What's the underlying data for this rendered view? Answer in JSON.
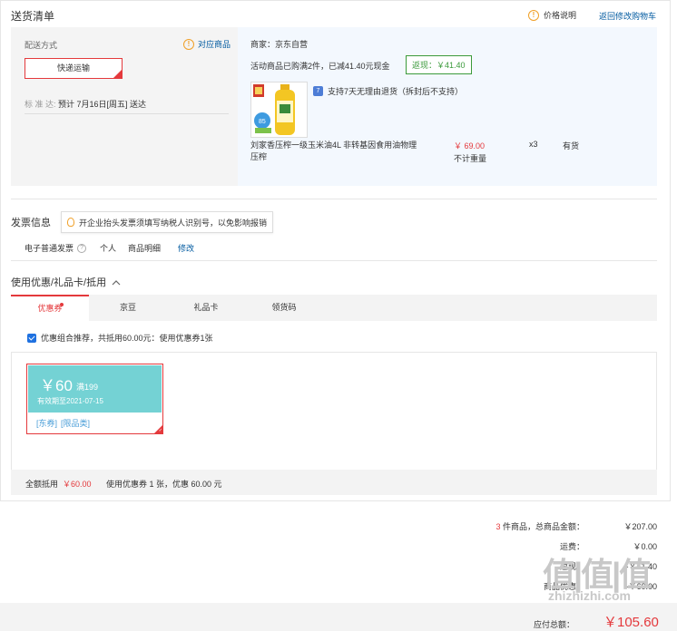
{
  "header": {
    "title": "送货清单",
    "price_explain": "价格说明",
    "back_cart": "返回修改购物车"
  },
  "shipping": {
    "label": "配送方式",
    "match_goods": "对应商品",
    "method": "快递运输",
    "std_label": "标 准 达:",
    "std_time": "预计 7月16日[周五] 送达"
  },
  "goods": {
    "merchant": "商家：京东自营",
    "promo": "活动商品已购满2件，已减41.40元现金",
    "cashback": "返现：￥41.40",
    "return_policy": "支持7天无理由退货（拆封后不支持）",
    "return_badge": "7",
    "name": "刘家香压榨一级玉米油4L 非转基因食用油物理压榨",
    "price": "￥ 69.00",
    "no_weight": "不计重量",
    "qty": "x3",
    "stock": "有货",
    "img_badge": "85"
  },
  "invoice": {
    "title": "发票信息",
    "tip": "开企业抬头发票须填写纳税人识别号，以免影响报销",
    "type": "电子普通发票",
    "person": "个人",
    "detail": "商品明细",
    "edit": "修改"
  },
  "coupon": {
    "title": "使用优惠/礼品卡/抵用",
    "tabs": [
      "优惠券",
      "京豆",
      "礼品卡",
      "领货码"
    ],
    "combo": "优惠组合推荐，共抵用60.00元：使用优惠券1张",
    "card": {
      "amount": "￥60",
      "cond": "满199",
      "date": "有效期至2021-07-15",
      "tags": [
        "[东券]",
        "[限品类]"
      ]
    },
    "summary_label": "全额抵用",
    "summary_amount": "￥60.00",
    "summary_detail": "使用优惠券 1 张，优惠 60.00 元"
  },
  "totals": {
    "count": "3",
    "goods_label": "件商品，总商品金额：",
    "goods_value": "￥207.00",
    "freight_label": "运费：",
    "freight_value": "￥0.00",
    "cut_label": "返现：",
    "cut_value": "-￥41.40",
    "merchant_label": "商品优惠：",
    "merchant_value": "-￥60.00",
    "pay_label": "应付总额：",
    "pay_value": "￥105.60"
  },
  "watermark": {
    "text": "值|值|值",
    "sub": "zhizhizhi.com"
  },
  "colors": {
    "accent": "#e4393c",
    "link": "#005aa0",
    "coupon": "#74d2d4",
    "green": "#3b9a3b"
  }
}
